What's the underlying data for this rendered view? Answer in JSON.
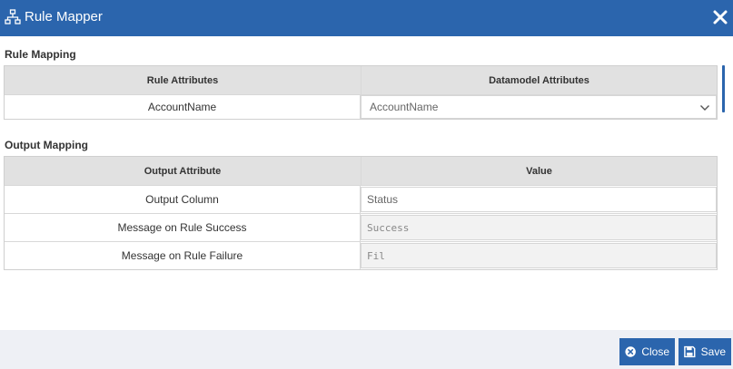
{
  "dialog": {
    "title": "Rule Mapper",
    "title_icon": "tree-structure-icon",
    "close_icon": "close-x-icon",
    "accent_color": "#2b65ad"
  },
  "rule_mapping": {
    "section_title": "Rule Mapping",
    "headers": [
      "Rule Attributes",
      "Datamodel Attributes"
    ],
    "rows": [
      {
        "rule_attribute": "AccountName",
        "datamodel_attribute": "AccountName"
      }
    ]
  },
  "output_mapping": {
    "section_title": "Output Mapping",
    "headers": [
      "Output Attribute",
      "Value"
    ],
    "rows": [
      {
        "attribute": "Output Column",
        "value": "Status"
      },
      {
        "attribute": "Message on Rule Success",
        "value": "Success"
      },
      {
        "attribute": "Message on Rule Failure",
        "value": "Fil"
      }
    ]
  },
  "footer": {
    "close_label": "Close",
    "save_label": "Save"
  }
}
